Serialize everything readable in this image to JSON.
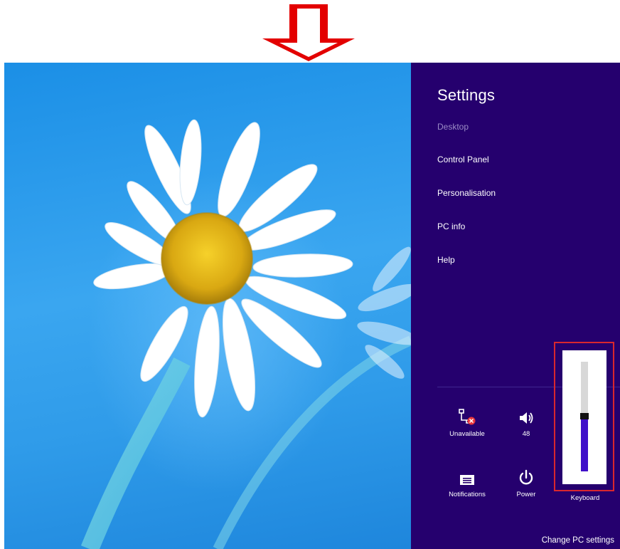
{
  "settings": {
    "title": "Settings",
    "menu": [
      {
        "label": "Desktop",
        "dim": true
      },
      {
        "label": "Control Panel",
        "dim": false
      },
      {
        "label": "Personalisation",
        "dim": false
      },
      {
        "label": "PC info",
        "dim": false
      },
      {
        "label": "Help",
        "dim": false
      }
    ],
    "tiles": {
      "network": {
        "label": "Unavailable",
        "icon": "network-unavailable-icon"
      },
      "volume": {
        "label": "48",
        "icon": "speaker-icon"
      },
      "notifications": {
        "label": "Notifications",
        "icon": "notifications-icon"
      },
      "power": {
        "label": "Power",
        "icon": "power-icon"
      },
      "keyboard": {
        "label": "Keyboard",
        "icon": "keyboard-icon"
      }
    },
    "change_pc_settings": "Change PC settings"
  },
  "volume_slider": {
    "level": 48,
    "max": 100
  },
  "colors": {
    "panel_background": "#25006e",
    "annotation_red": "#e30000",
    "slider_fill": "#3f10c9"
  }
}
